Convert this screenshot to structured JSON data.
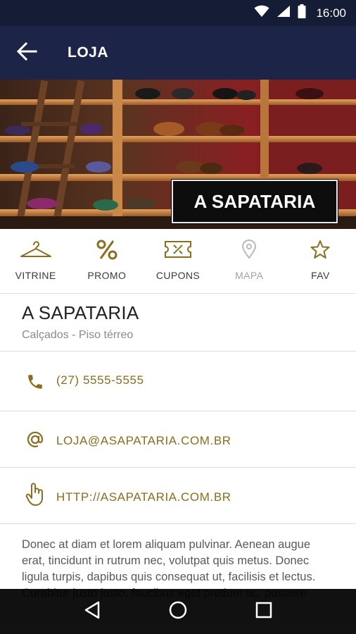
{
  "status_bar": {
    "time": "16:00",
    "icons": [
      "wifi-icon",
      "signal-icon",
      "battery-icon"
    ]
  },
  "app_bar": {
    "back_icon": "arrow-left-icon",
    "title": "LOJA"
  },
  "hero": {
    "logo_text": "A SAPATARIA"
  },
  "tabs": [
    {
      "label": "VITRINE",
      "icon": "hanger-icon",
      "muted": false
    },
    {
      "label": "PROMO",
      "icon": "percent-icon",
      "muted": false
    },
    {
      "label": "CUPONS",
      "icon": "coupon-icon",
      "muted": false
    },
    {
      "label": "MAPA",
      "icon": "map-pin-icon",
      "muted": true
    },
    {
      "label": "FAV",
      "icon": "star-icon",
      "muted": false
    }
  ],
  "store": {
    "name": "A SAPATARIA",
    "subtitle": "Calçados - Piso térreo"
  },
  "contacts": {
    "phone": "(27) 5555-5555",
    "email": "LOJA@ASAPATARIA.COM.BR",
    "website": "HTTP://ASAPATARIA.COM.BR"
  },
  "description": "Donec at diam et lorem aliquam pulvinar. Aenean augue erat, tincidunt in rutrum nec, volutpat quis metus. Donec ligula turpis, dapibus quis consequat ut, facilisis et lectus. Curabitur justo justo, faucibus eget pretium ac, posuere",
  "colors": {
    "status_bar": "#151c36",
    "app_bar": "#1c2548",
    "accent_gold": "#8a6d1e",
    "nav_bar": "#000000"
  },
  "nav": [
    "back-triangle-icon",
    "home-circle-icon",
    "recents-square-icon"
  ]
}
